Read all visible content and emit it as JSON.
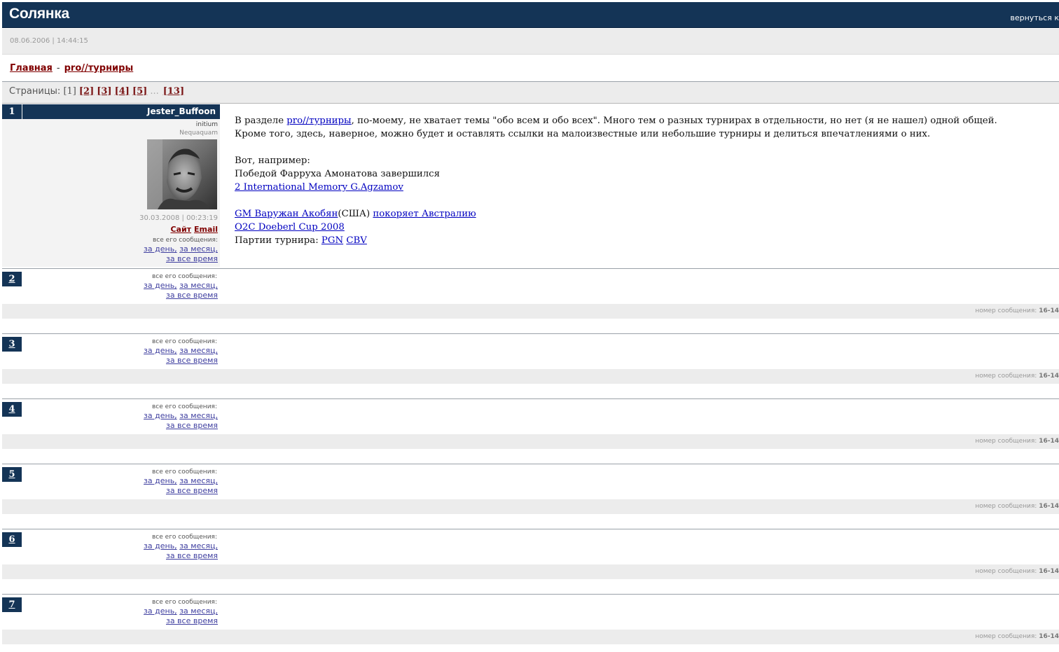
{
  "header": {
    "title": "Солянка",
    "back_link": "вернуться к"
  },
  "dateline": "08.06.2006 | 14:44:15",
  "breadcrumb": {
    "home": "Главная",
    "separator": "-",
    "section": "pro//турниры"
  },
  "pager": {
    "label": "Страницы:",
    "current": "[1]",
    "pages": [
      "[2]",
      "[3]",
      "[4]",
      "[5]"
    ],
    "dots": "...",
    "last": "[13]"
  },
  "author_links": {
    "all_label": "все его сообщения:",
    "day": "за день,",
    "month": "за месяц,",
    "all_time": "за все время"
  },
  "first_post": {
    "number": "1",
    "author": "Jester_Buffoon",
    "rank": "initium",
    "motto": "Nequaquam",
    "date": "30.03.2008 | 00:23:19",
    "site": "Сайт",
    "email": "Email",
    "body": {
      "p1_a": "В разделе ",
      "p1_link": "pro//турниры",
      "p1_b": ", по-моему, не хватает темы \"обо всем и обо всех\". Много тем о разных турнирах в отдельности, но нет (я не нашел) одной общей.",
      "p2": "Кроме того, здесь, наверное, можно будет и оставлять ссылки на малоизвестные или небольшие турниры и делиться впечатлениями о них.",
      "p3": "Вот, например:",
      "p4": "Победой Фарруха Амонатова завершился",
      "link_memory": "2 International Memory G.Agzamov",
      "link_gm": "GM Варужан Акобян",
      "usa": "(США) ",
      "link_australia": "покоряет Австралию",
      "link_o2c": "O2C Doeberl Cup 2008",
      "games_label": "Партии турнира: ",
      "link_pgn": "PGN",
      "link_cbv": "CBV"
    }
  },
  "posts": [
    {
      "number": "2",
      "msgnum_label": "номер сообщения:",
      "msgnum": "16-14"
    },
    {
      "number": "3",
      "msgnum_label": "номер сообщения:",
      "msgnum": "16-14"
    },
    {
      "number": "4",
      "msgnum_label": "номер сообщения:",
      "msgnum": "16-14"
    },
    {
      "number": "5",
      "msgnum_label": "номер сообщения:",
      "msgnum": "16-14"
    },
    {
      "number": "6",
      "msgnum_label": "номер сообщения:",
      "msgnum": "16-14"
    },
    {
      "number": "7",
      "msgnum_label": "номер сообщения:",
      "msgnum": "16-14"
    }
  ]
}
